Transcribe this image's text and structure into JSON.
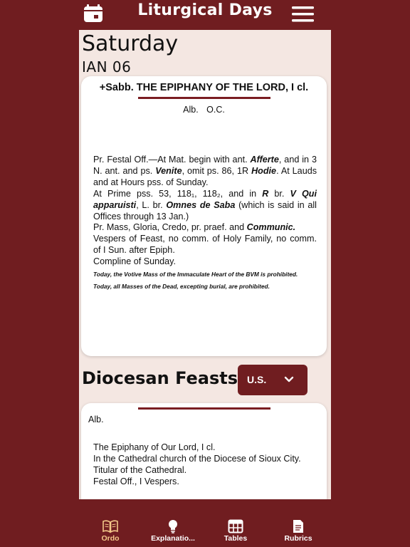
{
  "header": {
    "title": "Liturgical Days",
    "left_icon": "calendar-icon",
    "right_icon": "hamburger-menu-icon"
  },
  "day": {
    "name": "Saturday",
    "date": "IAN 06"
  },
  "ordo_card": {
    "title": "+Sabb. THE EPIPHANY OF THE LORD, I cl.",
    "colors": [
      "Alb.",
      "O.C."
    ],
    "lines": [
      {
        "parts": [
          {
            "t": "Pr. Festal Off.—At Mat. begin with ant. "
          },
          {
            "t": "Afferte",
            "em": true
          },
          {
            "t": ", and in 3 N. ant. and ps. "
          },
          {
            "t": "Venite",
            "em": true
          },
          {
            "t": ", omit ps. 86, 1R "
          },
          {
            "t": "Hodie",
            "em": true
          },
          {
            "t": ". At Lauds and at Hours pss. of Sunday."
          }
        ]
      },
      {
        "parts": [
          {
            "t": "At Prime pss. 53, 118₁, 118₂, and in "
          },
          {
            "t": "R",
            "em": true
          },
          {
            "t": " br. "
          },
          {
            "t": "V Qui apparuisti",
            "em": true
          },
          {
            "t": ", L. br. "
          },
          {
            "t": "Omnes de Saba",
            "em": true
          },
          {
            "t": " (which is said in all Offices through 13 Jan.)"
          }
        ]
      },
      {
        "parts": [
          {
            "t": "Pr. Mass, Gloria, Credo, pr. praef. and "
          },
          {
            "t": "Communic.",
            "em": true
          }
        ]
      },
      {
        "parts": [
          {
            "t": "Vespers of Feast, no comm. of Holy Family, no comm. of I Sun. after Epiph."
          }
        ]
      },
      {
        "parts": [
          {
            "t": "Compline of Sunday."
          }
        ]
      }
    ],
    "notes": [
      "Today, the Votive Mass of the Immaculate Heart of the BVM is prohibited.",
      "Today, all Masses of the Dead, excepting burial, are prohibited."
    ]
  },
  "diocesan": {
    "title": "Diocesan Feasts",
    "region_select": {
      "value": "U.S.",
      "icon": "chevron-down-icon"
    },
    "color": "Alb.",
    "lines": [
      "The Epiphany of Our Lord, I cl.",
      "In the Cathedral church of the Diocese of Sioux City.",
      "Titular of the Cathedral.",
      "Festal Off., I Vespers."
    ]
  },
  "tabs": [
    {
      "label": "Ordo",
      "icon": "book-open-icon",
      "active": true
    },
    {
      "label": "Explanatio...",
      "icon": "lightbulb-icon",
      "active": false
    },
    {
      "label": "Tables",
      "icon": "table-icon",
      "active": false
    },
    {
      "label": "Rubrics",
      "icon": "document-icon",
      "active": false
    }
  ],
  "colors": {
    "brand": "#701d20",
    "page_bg": "#f4e7e2",
    "active_tab": "#f4c98a"
  }
}
